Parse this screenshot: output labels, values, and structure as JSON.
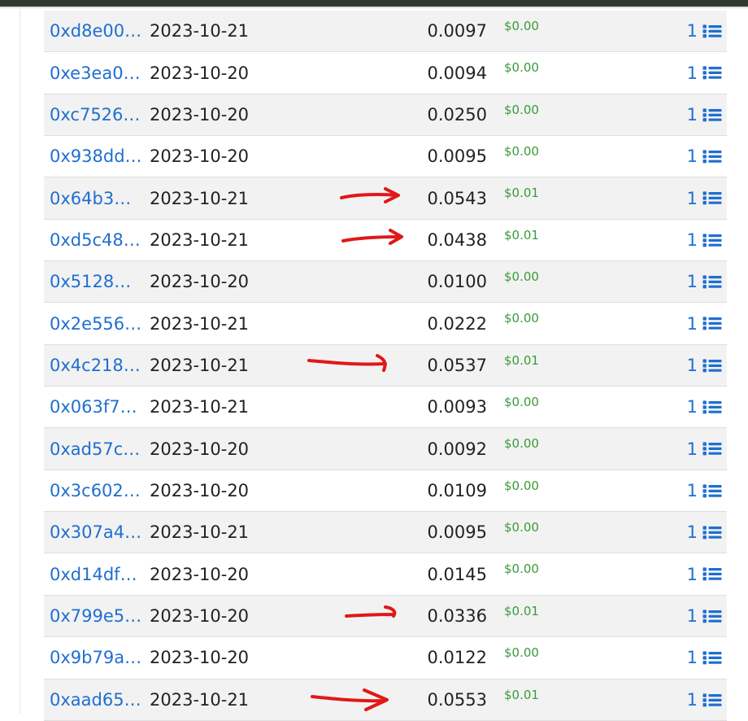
{
  "transactions": [
    {
      "hash": "0xd8e00…",
      "date": "2023-10-21",
      "amount": "0.0097",
      "usd": "$0.00",
      "count": "1",
      "marked": false
    },
    {
      "hash": "0xe3ea0…",
      "date": "2023-10-20",
      "amount": "0.0094",
      "usd": "$0.00",
      "count": "1",
      "marked": false
    },
    {
      "hash": "0xc7526…",
      "date": "2023-10-20",
      "amount": "0.0250",
      "usd": "$0.00",
      "count": "1",
      "marked": false
    },
    {
      "hash": "0x938dd…",
      "date": "2023-10-20",
      "amount": "0.0095",
      "usd": "$0.00",
      "count": "1",
      "marked": false
    },
    {
      "hash": "0x64b3…",
      "date": "2023-10-21",
      "amount": "0.0543",
      "usd": "$0.01",
      "count": "1",
      "marked": true
    },
    {
      "hash": "0xd5c48…",
      "date": "2023-10-21",
      "amount": "0.0438",
      "usd": "$0.01",
      "count": "1",
      "marked": true
    },
    {
      "hash": "0x5128…",
      "date": "2023-10-20",
      "amount": "0.0100",
      "usd": "$0.00",
      "count": "1",
      "marked": false
    },
    {
      "hash": "0x2e556…",
      "date": "2023-10-21",
      "amount": "0.0222",
      "usd": "$0.00",
      "count": "1",
      "marked": false
    },
    {
      "hash": "0x4c218…",
      "date": "2023-10-21",
      "amount": "0.0537",
      "usd": "$0.01",
      "count": "1",
      "marked": true
    },
    {
      "hash": "0x063f7…",
      "date": "2023-10-21",
      "amount": "0.0093",
      "usd": "$0.00",
      "count": "1",
      "marked": false
    },
    {
      "hash": "0xad57c…",
      "date": "2023-10-20",
      "amount": "0.0092",
      "usd": "$0.00",
      "count": "1",
      "marked": false
    },
    {
      "hash": "0x3c602…",
      "date": "2023-10-20",
      "amount": "0.0109",
      "usd": "$0.00",
      "count": "1",
      "marked": false
    },
    {
      "hash": "0x307a4…",
      "date": "2023-10-21",
      "amount": "0.0095",
      "usd": "$0.00",
      "count": "1",
      "marked": false
    },
    {
      "hash": "0xd14df…",
      "date": "2023-10-20",
      "amount": "0.0145",
      "usd": "$0.00",
      "count": "1",
      "marked": false
    },
    {
      "hash": "0x799e5…",
      "date": "2023-10-20",
      "amount": "0.0336",
      "usd": "$0.01",
      "count": "1",
      "marked": true
    },
    {
      "hash": "0x9b79a…",
      "date": "2023-10-20",
      "amount": "0.0122",
      "usd": "$0.00",
      "count": "1",
      "marked": false
    },
    {
      "hash": "0xaad65…",
      "date": "2023-10-21",
      "amount": "0.0553",
      "usd": "$0.01",
      "count": "1",
      "marked": true
    }
  ],
  "colors": {
    "link": "#1f6fd0",
    "usd": "#3a9a3a",
    "annotation_arrow": "#e01818",
    "stripe": "#f2f2f2",
    "top_bar": "#2f3b2c"
  },
  "icons": {
    "row_action": "list-icon",
    "annotation": "red-arrow-annotation"
  }
}
